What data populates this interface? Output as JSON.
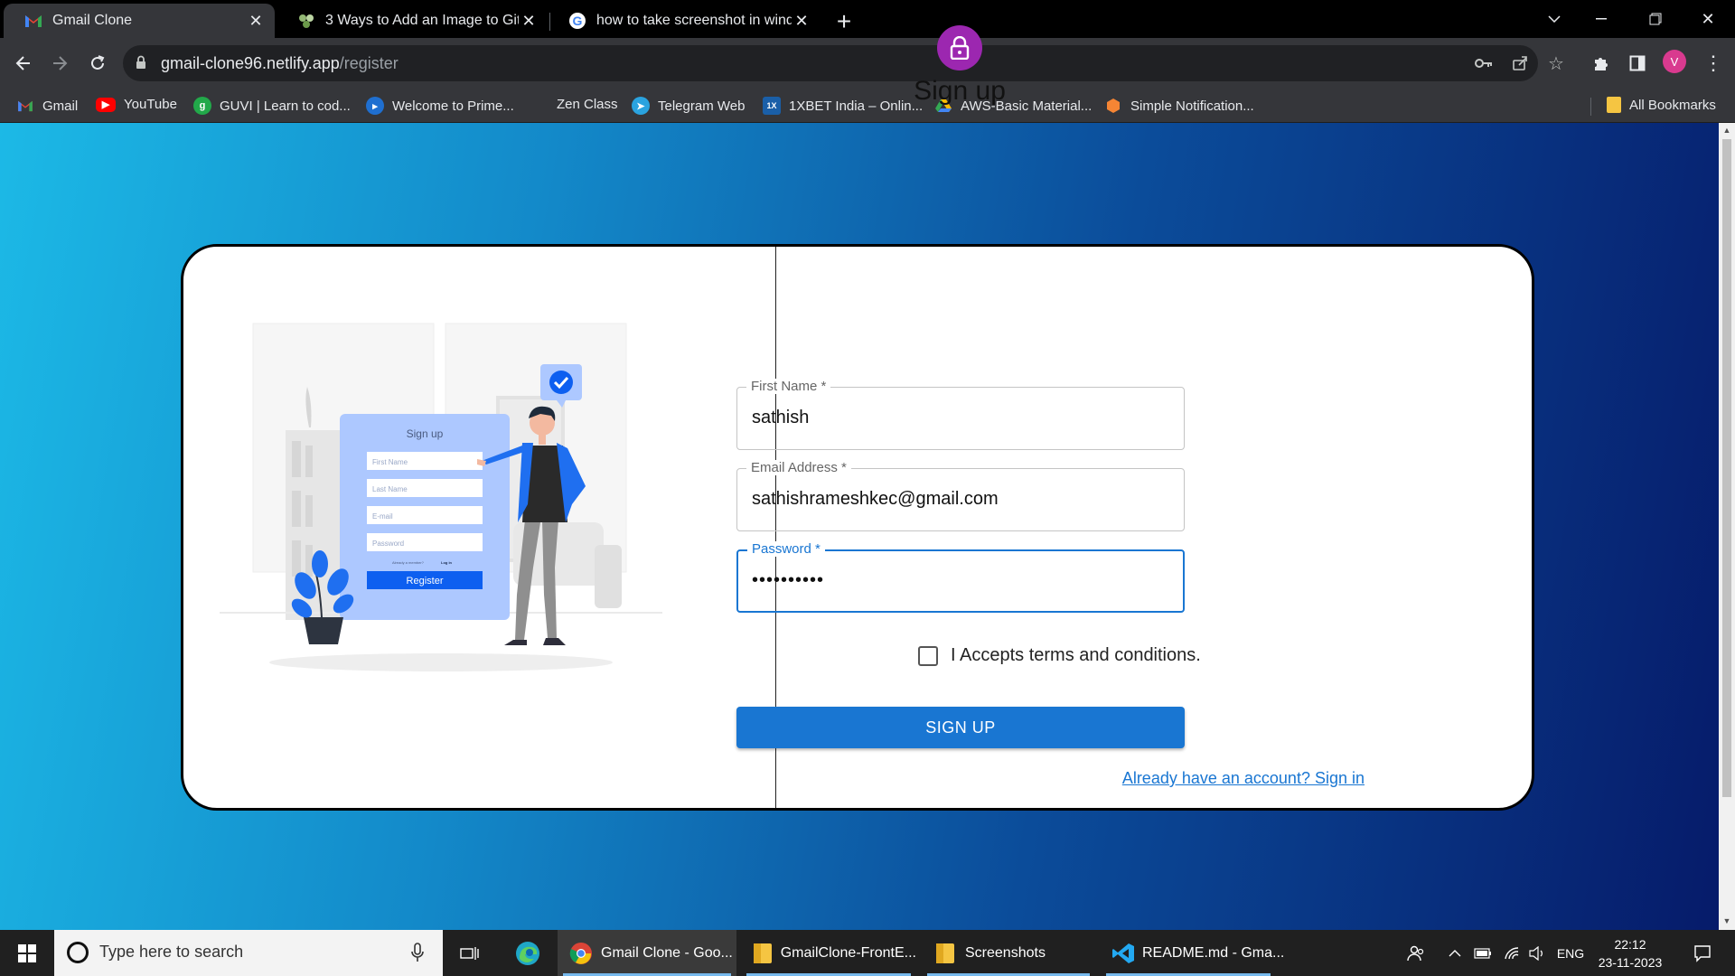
{
  "browser": {
    "tabs": [
      {
        "title": "Gmail Clone",
        "active": true
      },
      {
        "title": "3 Ways to Add an Image to GitH",
        "active": false
      },
      {
        "title": "how to take screenshot in windo",
        "active": false
      }
    ],
    "url_host": "gmail-clone96.netlify.app",
    "url_path": "/register",
    "profile_initial": "V",
    "bookmarks": [
      "Gmail",
      "YouTube",
      "GUVI | Learn to cod...",
      "Welcome to Prime...",
      "Zen Class",
      "Telegram Web",
      "1XBET India – Onlin...",
      "AWS-Basic Material...",
      "Simple Notification..."
    ],
    "all_bookmarks": "All Bookmarks"
  },
  "illustration": {
    "title": "Sign up",
    "fields": [
      "First Name",
      "Last Name",
      "E-mail",
      "Password"
    ],
    "footer_text": "Already a member?",
    "footer_link": "Log in",
    "button": "Register"
  },
  "form": {
    "title": "Sign up",
    "first_name": {
      "label": "First Name *",
      "value": "sathish"
    },
    "email": {
      "label": "Email Address *",
      "value": "sathishrameshkec@gmail.com"
    },
    "password": {
      "label": "Password *",
      "value": "••••••••••"
    },
    "terms_label": "I Accepts terms and conditions.",
    "submit": "SIGN UP",
    "signin_link": "Already have an account? Sign in"
  },
  "taskbar": {
    "search_placeholder": "Type here to search",
    "apps": [
      "Gmail Clone - Goo...",
      "GmailClone-FrontE...",
      "Screenshots",
      "README.md - Gma..."
    ],
    "language": "ENG",
    "time": "22:12",
    "date": "23-11-2023"
  },
  "colors": {
    "primary": "#1976d2",
    "avatar_purple": "#9c27b0",
    "gradient_start": "#1cb9e6",
    "gradient_end": "#061b6a"
  }
}
